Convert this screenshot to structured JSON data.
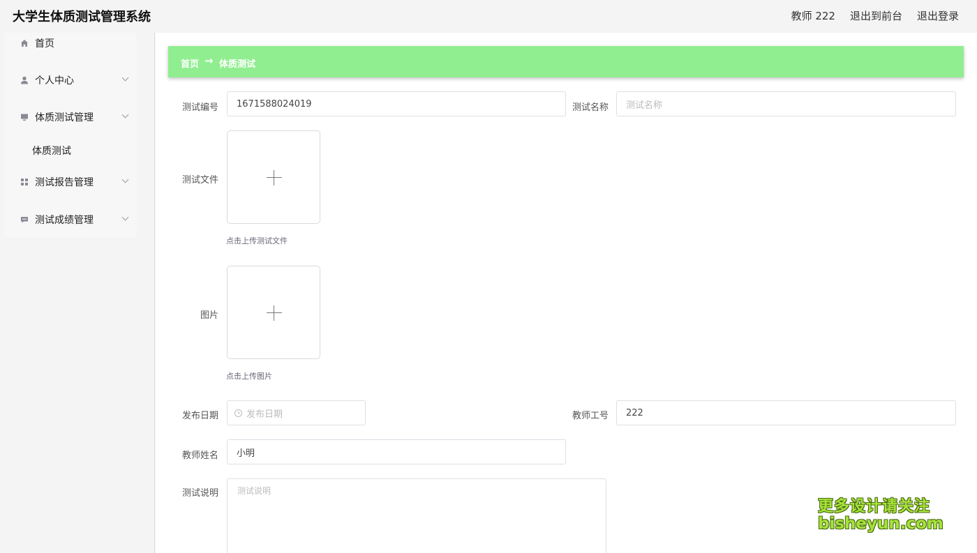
{
  "header": {
    "app_title": "大学生体质测试管理系统",
    "user_label": "教师 222",
    "exit_front": "退出到前台",
    "logout": "退出登录"
  },
  "sidebar": {
    "items": [
      {
        "label": "首页",
        "icon": "home-icon"
      },
      {
        "label": "个人中心",
        "icon": "user-icon"
      },
      {
        "label": "体质测试管理",
        "icon": "monitor-icon"
      },
      {
        "label": "体质测试",
        "icon": ""
      },
      {
        "label": "测试报告管理",
        "icon": "grid-icon"
      },
      {
        "label": "测试成绩管理",
        "icon": "message-icon"
      }
    ]
  },
  "breadcrumb": {
    "home": "首页",
    "arrow": "→",
    "current": "体质测试"
  },
  "form": {
    "test_no_label": "测试编号",
    "test_no_value": "1671588024019",
    "test_name_label": "测试名称",
    "test_name_placeholder": "测试名称",
    "test_file_label": "测试文件",
    "test_file_hint": "点击上传测试文件",
    "image_label": "图片",
    "image_hint": "点击上传图片",
    "publish_date_label": "发布日期",
    "publish_date_placeholder": "发布日期",
    "teacher_id_label": "教师工号",
    "teacher_id_value": "222",
    "teacher_name_label": "教师姓名",
    "teacher_name_value": "小明",
    "desc_label": "测试说明",
    "desc_placeholder": "测试说明"
  },
  "watermark": {
    "line1": "更多设计请关注",
    "line2": "bisheyun.com"
  },
  "colors": {
    "breadcrumb_bg": "#90ee90",
    "sidebar_bg": "#f4f4f5"
  }
}
